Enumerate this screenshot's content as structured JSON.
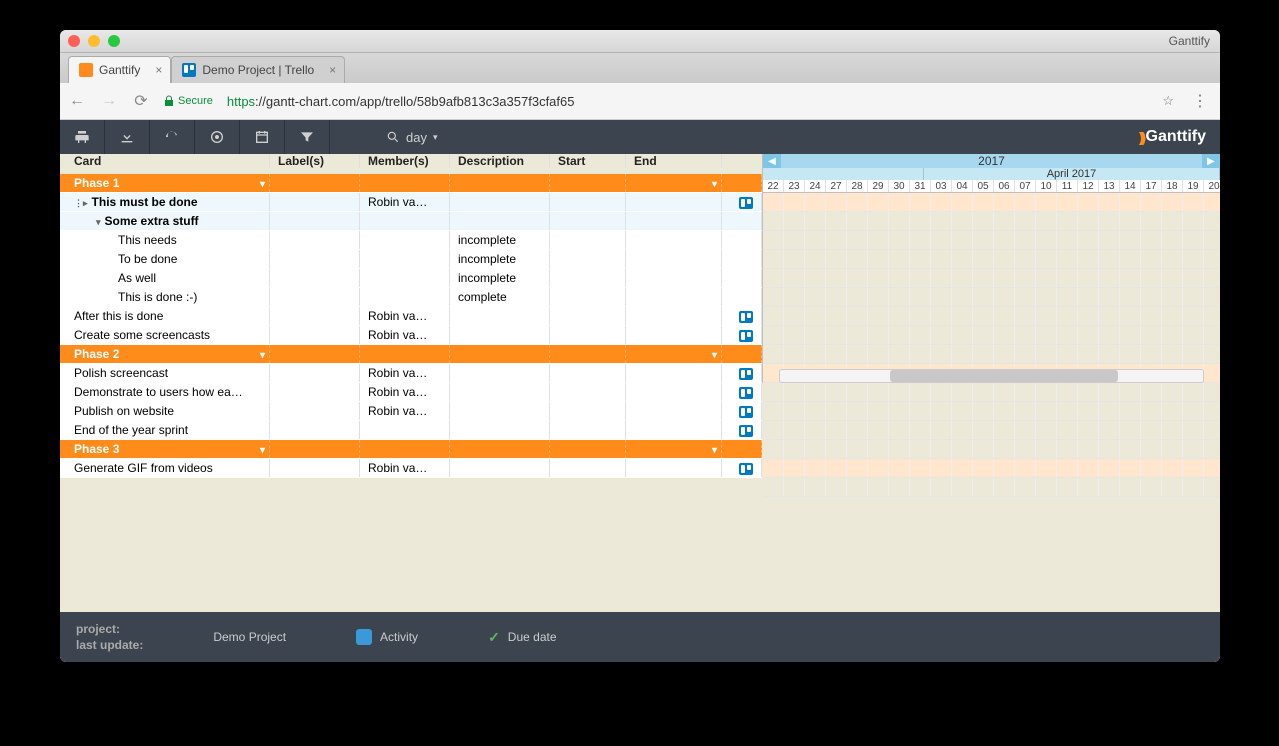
{
  "window": {
    "app_name": "Ganttify",
    "tabs": [
      {
        "label": "Ganttify",
        "active": true
      },
      {
        "label": "Demo Project | Trello",
        "active": false
      }
    ],
    "secure_label": "Secure",
    "url_https": "https",
    "url_rest": "://gantt-chart.com/app/trello/58b9afb813c3a357f3cfaf65"
  },
  "toolbar": {
    "zoom_label": "day",
    "brand": "Ganttify"
  },
  "columns": {
    "card": "Card",
    "labels": "Label(s)",
    "members": "Member(s)",
    "description": "Description",
    "start": "Start",
    "end": "End"
  },
  "timeline": {
    "year": "2017",
    "month_label": "April 2017",
    "days": [
      "22",
      "23",
      "24",
      "27",
      "28",
      "29",
      "30",
      "31",
      "03",
      "04",
      "05",
      "06",
      "07",
      "10",
      "11",
      "12",
      "13",
      "14",
      "17",
      "18",
      "19",
      "20"
    ]
  },
  "rows": [
    {
      "type": "phase",
      "card": "Phase 1"
    },
    {
      "type": "task",
      "card": "This must be done",
      "member": "Robin va…",
      "bold": true,
      "trello": true,
      "expander": true,
      "indent": 0
    },
    {
      "type": "task",
      "card": "Some extra stuff",
      "bold": true,
      "expander_open": true,
      "indent": 1
    },
    {
      "type": "task",
      "card": "This needs",
      "desc": "incomplete",
      "indent": 2,
      "white": true
    },
    {
      "type": "task",
      "card": "To be done",
      "desc": "incomplete",
      "indent": 2,
      "white": true
    },
    {
      "type": "task",
      "card": "As well",
      "desc": "incomplete",
      "indent": 2,
      "white": true
    },
    {
      "type": "task",
      "card": "This is done :-)",
      "desc": "complete",
      "indent": 2,
      "white": true
    },
    {
      "type": "task",
      "card": "After this is done",
      "member": "Robin va…",
      "trello": true,
      "indent": 0,
      "white": true
    },
    {
      "type": "task",
      "card": "Create some screencasts",
      "member": "Robin va…",
      "trello": true,
      "indent": 0,
      "white": true
    },
    {
      "type": "phase",
      "card": "Phase 2"
    },
    {
      "type": "task",
      "card": "Polish screencast",
      "member": "Robin va…",
      "trello": true,
      "indent": 0,
      "white": true
    },
    {
      "type": "task",
      "card": "Demonstrate to users how ea…",
      "member": "Robin va…",
      "trello": true,
      "indent": 0,
      "white": true
    },
    {
      "type": "task",
      "card": "Publish on website",
      "member": "Robin va…",
      "trello": true,
      "indent": 0,
      "white": true
    },
    {
      "type": "task",
      "card": "End of the year sprint",
      "trello": true,
      "indent": 0,
      "white": true
    },
    {
      "type": "phase",
      "card": "Phase 3"
    },
    {
      "type": "task",
      "card": "Generate GIF from videos",
      "member": "Robin va…",
      "trello": true,
      "indent": 0,
      "white": true
    }
  ],
  "footer": {
    "project_label": "project:",
    "project_name": "Demo Project",
    "update_label": "last update:",
    "activity": "Activity",
    "duedate": "Due date"
  }
}
